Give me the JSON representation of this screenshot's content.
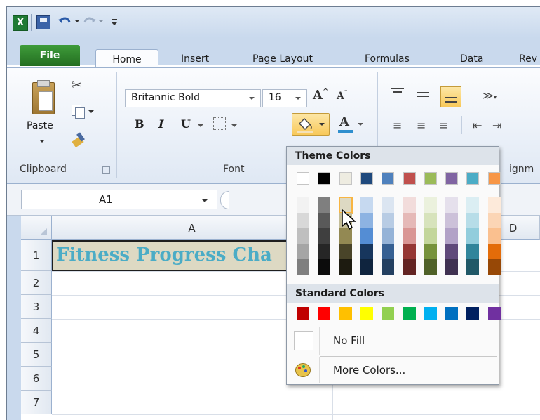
{
  "title_bar": {
    "quick_access": [
      "excel-icon",
      "save-icon",
      "undo-icon",
      "redo-icon",
      "customize-icon"
    ]
  },
  "tabs": [
    {
      "label": "File"
    },
    {
      "label": "Home"
    },
    {
      "label": "Insert"
    },
    {
      "label": "Page Layout"
    },
    {
      "label": "Formulas"
    },
    {
      "label": "Data"
    },
    {
      "label": "Rev"
    }
  ],
  "ribbon": {
    "clipboard": {
      "paste_label": "Paste",
      "group_label": "Clipboard"
    },
    "font": {
      "family": "Britannic Bold",
      "size": "16",
      "bold": "B",
      "italic": "I",
      "underline": "U",
      "color_letter": "A",
      "group_label": "Font"
    },
    "alignment": {
      "group_label": "ignm"
    }
  },
  "formula_bar": {
    "name_box": "A1"
  },
  "grid": {
    "columns": [
      "A",
      "D"
    ],
    "rows": [
      "1",
      "2",
      "3",
      "4",
      "5",
      "6",
      "7"
    ],
    "cell_a1": "Fitness Progress Cha"
  },
  "fill_dropdown": {
    "theme_header": "Theme Colors",
    "standard_header": "Standard Colors",
    "no_fill": "No Fill",
    "more_colors": "More Colors...",
    "theme_base": [
      "#FFFFFF",
      "#000000",
      "#EEECE1",
      "#1F497D",
      "#4F81BD",
      "#C0504D",
      "#9BBB59",
      "#8064A2",
      "#4BACC6",
      "#F79646"
    ],
    "theme_tints": [
      [
        "#F2F2F2",
        "#D8D8D8",
        "#BFBFBF",
        "#A5A5A5",
        "#7F7F7F"
      ],
      [
        "#7F7F7F",
        "#595959",
        "#3F3F3F",
        "#262626",
        "#0C0C0C"
      ],
      [
        "#DDD9C3",
        "#C4BD97",
        "#938953",
        "#494429",
        "#1D1B10"
      ],
      [
        "#C6D9F0",
        "#8DB3E2",
        "#548DD4",
        "#17365D",
        "#0F243E"
      ],
      [
        "#DBE5F1",
        "#B8CCE4",
        "#95B3D7",
        "#366092",
        "#244061"
      ],
      [
        "#F2DCDB",
        "#E5B9B7",
        "#D99694",
        "#953734",
        "#632423"
      ],
      [
        "#EBF1DD",
        "#D7E3BC",
        "#C3D69B",
        "#76923C",
        "#4F6128"
      ],
      [
        "#E5E0EC",
        "#CCC1D9",
        "#B2A2C7",
        "#5F497A",
        "#3F3151"
      ],
      [
        "#DBEEF3",
        "#B7DDE8",
        "#92CDDC",
        "#31859B",
        "#205867"
      ],
      [
        "#FDEADA",
        "#FBD5B5",
        "#FAC08F",
        "#E36C09",
        "#974806"
      ]
    ],
    "standard": [
      "#C00000",
      "#FF0000",
      "#FFC000",
      "#FFFF00",
      "#92D050",
      "#00B050",
      "#00B0F0",
      "#0070C0",
      "#002060",
      "#7030A0"
    ],
    "selected_accent": "#F8B542"
  }
}
